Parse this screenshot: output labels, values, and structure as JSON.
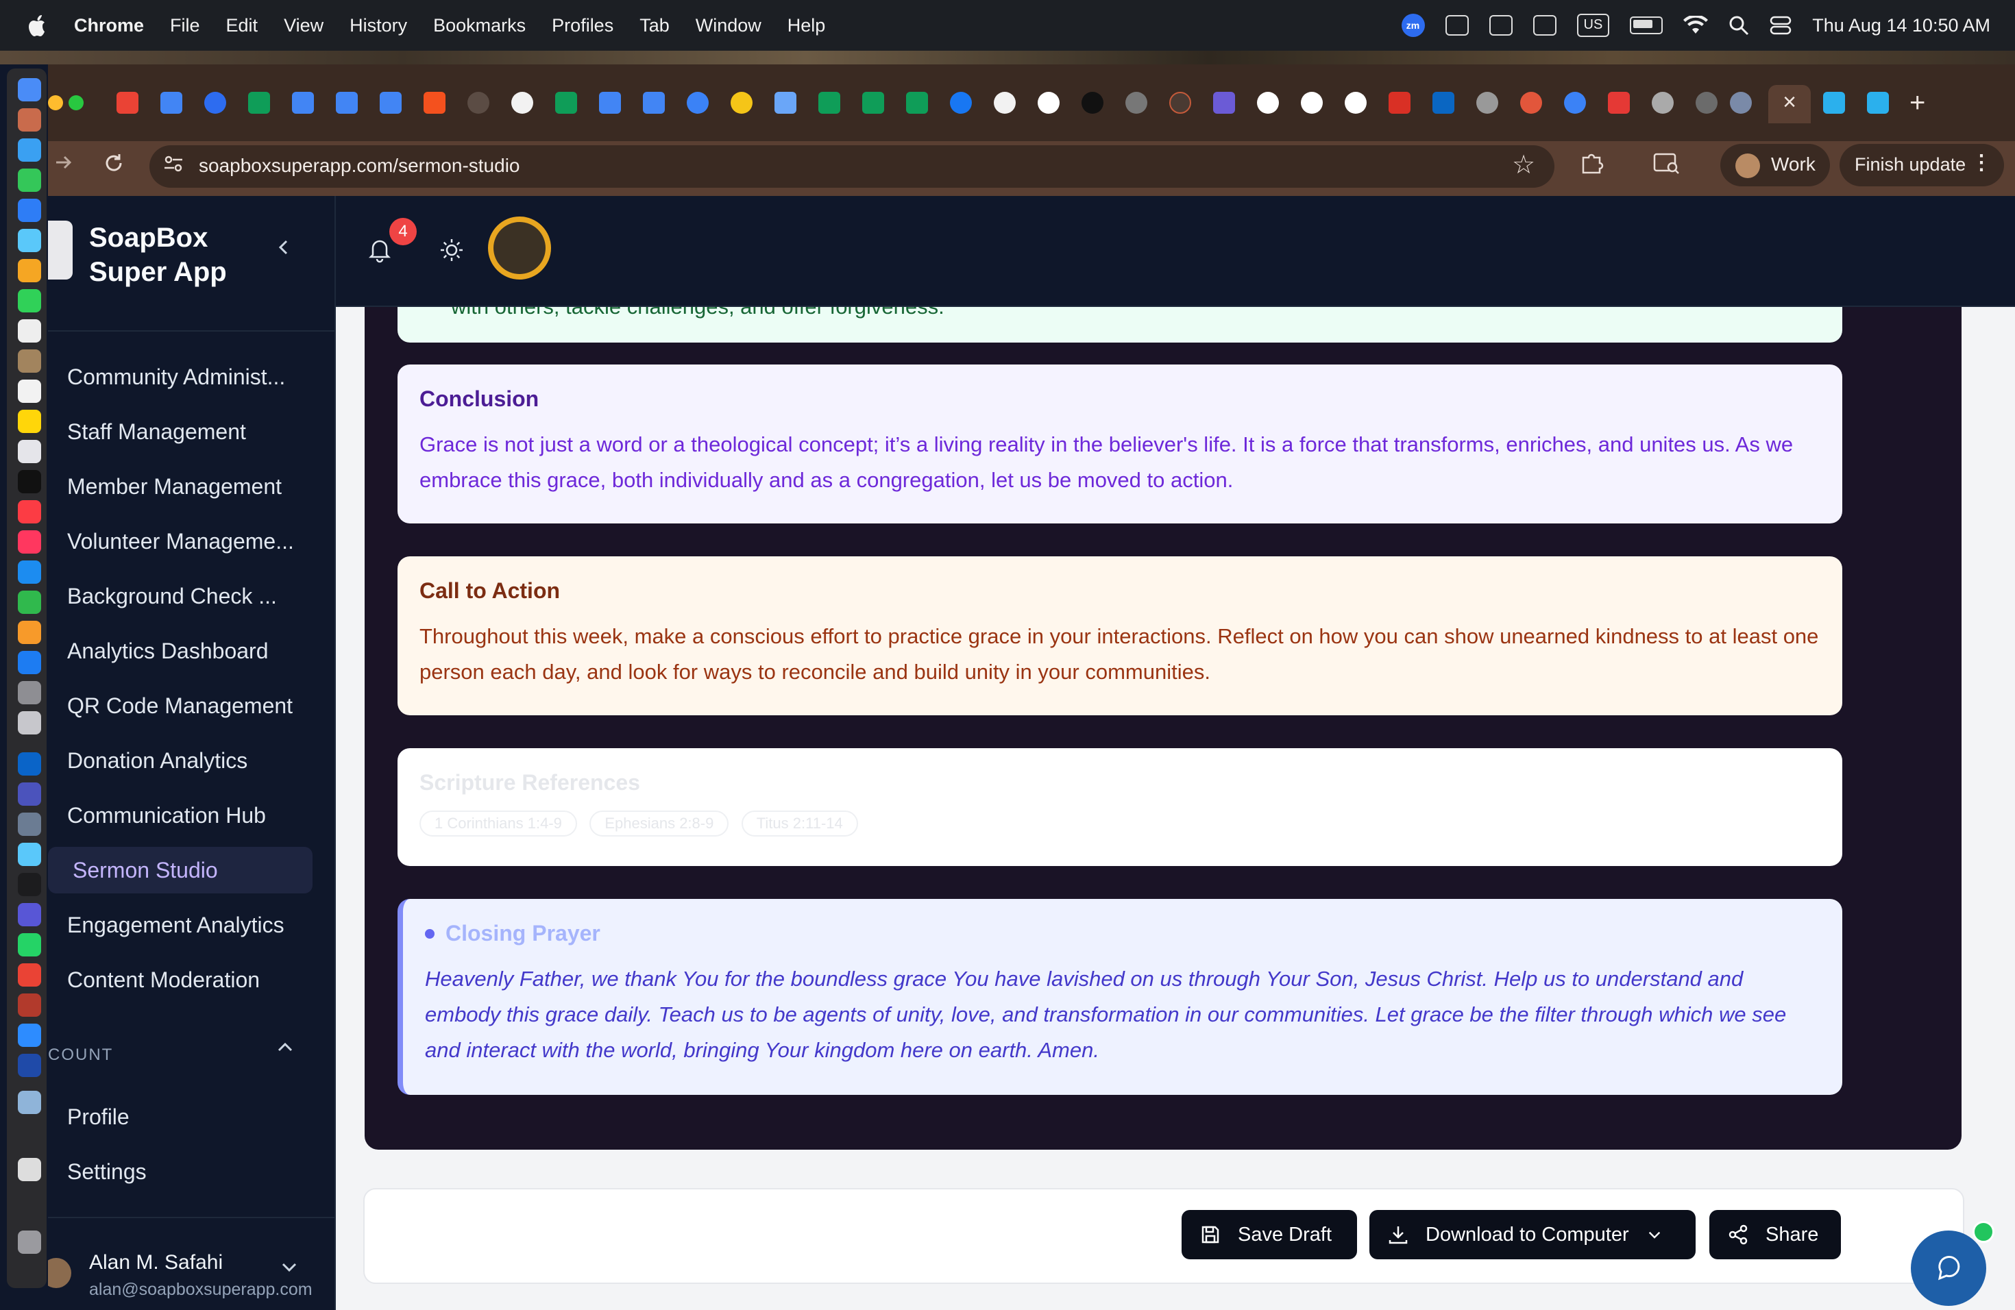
{
  "menubar": {
    "app": "Chrome",
    "items": [
      "File",
      "Edit",
      "View",
      "History",
      "Bookmarks",
      "Profiles",
      "Tab",
      "Window",
      "Help"
    ],
    "input_source": "US",
    "clock": "Thu Aug 14  10:50 AM",
    "zoom_badge": "zm"
  },
  "browser": {
    "url": "soapboxsuperapp.com/sermon-studio",
    "profile_name": "Work",
    "update_label": "Finish update",
    "close_tab_glyph": "×",
    "new_tab_glyph": "+"
  },
  "sidebar": {
    "brand": "SoapBox Super App",
    "brand_line1": "SoapBox",
    "brand_line2": "Super App",
    "items": [
      "Community Administ...",
      "Staff Management",
      "Member Management",
      "Volunteer Manageme...",
      "Background Check ...",
      "Analytics Dashboard",
      "QR Code Management",
      "Donation Analytics",
      "Communication Hub",
      "Sermon Studio",
      "Engagement Analytics",
      "Content Moderation"
    ],
    "active_item": "Sermon Studio",
    "account_section": "COUNT",
    "account_items": [
      "Profile",
      "Settings"
    ],
    "user": {
      "name": "Alan M. Safahi",
      "email": "alan@soapboxsuperapp.com"
    }
  },
  "topbar": {
    "notification_count": "4"
  },
  "sermon": {
    "top_fragment": "with others, tackle challenges, and offer forgiveness.",
    "conclusion": {
      "title": "Conclusion",
      "body": "Grace is not just a word or a theological concept; it’s a living reality in the believer's life. It is a force that transforms, enriches, and unites us. As we embrace this grace, both individually and as a congregation, let us be moved to action."
    },
    "call_to_action": {
      "title": "Call to Action",
      "body": "Throughout this week, make a conscious effort to practice grace in your interactions. Reflect on how you can show unearned kindness to at least one person each day, and look for ways to reconcile and build unity in your communities."
    },
    "scripture": {
      "title": "Scripture References",
      "refs": [
        "1 Corinthians 1:4-9",
        "Ephesians 2:8-9",
        "Titus 2:11-14"
      ]
    },
    "closing_prayer": {
      "title": "Closing Prayer",
      "body": "Heavenly Father, we thank You for the boundless grace You have lavished on us through Your Son, Jesus Christ. Help us to understand and embody this grace daily. Teach us to be agents of unity, love, and transformation in our communities. Let grace be the filter through which we see and interact with the world, bringing Your kingdom here on earth. Amen."
    }
  },
  "actions": {
    "save_draft": "Save Draft",
    "download": "Download to Computer",
    "share": "Share"
  }
}
